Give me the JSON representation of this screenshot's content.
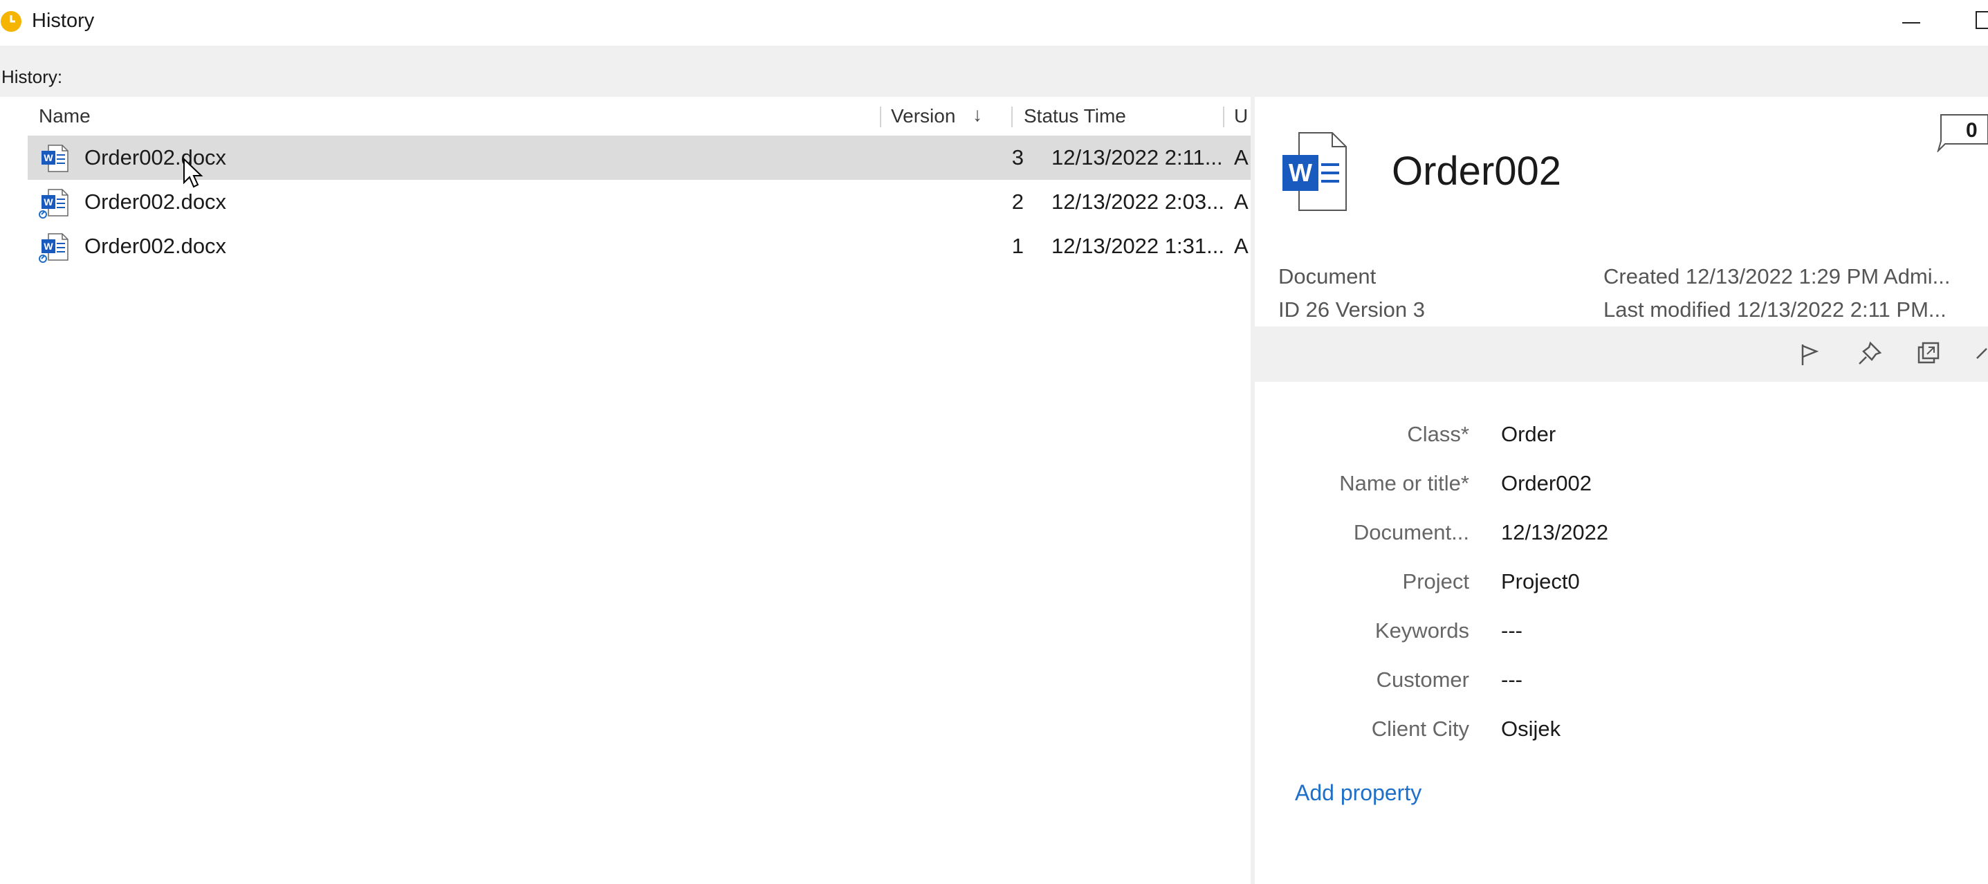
{
  "window": {
    "title": "History",
    "icon": "history-clock-icon"
  },
  "history_label": "History:",
  "columns": {
    "name": "Name",
    "version": "Version",
    "status_time": "Status Time",
    "user": "U"
  },
  "rows": [
    {
      "name": "Order002.docx",
      "version": "3",
      "status_time": "12/13/2022 2:11...",
      "user": "A",
      "selected": true,
      "icon": "word-document-icon"
    },
    {
      "name": "Order002.docx",
      "version": "2",
      "status_time": "12/13/2022 2:03...",
      "user": "A",
      "selected": false,
      "icon": "word-document-link-icon"
    },
    {
      "name": "Order002.docx",
      "version": "1",
      "status_time": "12/13/2022 1:31...",
      "user": "A",
      "selected": false,
      "icon": "word-document-link-icon"
    }
  ],
  "detail": {
    "title": "Order002",
    "comment_count": "0",
    "type": "Document",
    "id_version": "ID 26  Version 3",
    "created": "Created 12/13/2022 1:29 PM Admi...",
    "modified": "Last modified 12/13/2022 2:11 PM...",
    "properties": [
      {
        "label": "Class*",
        "value": "Order"
      },
      {
        "label": "Name or title*",
        "value": "Order002"
      },
      {
        "label": "Document...",
        "value": "12/13/2022"
      },
      {
        "label": "Project",
        "value": "Project0"
      },
      {
        "label": "Keywords",
        "value": "---"
      },
      {
        "label": "Customer",
        "value": "---"
      },
      {
        "label": "Client City",
        "value": "Osijek"
      }
    ],
    "add_property": "Add property"
  },
  "colors": {
    "accent_link": "#1e6fc9",
    "word_blue": "#185abd",
    "selected_row": "#dcdcdc",
    "strip": "#f0f0f0",
    "title_icon": "#f5b400"
  }
}
